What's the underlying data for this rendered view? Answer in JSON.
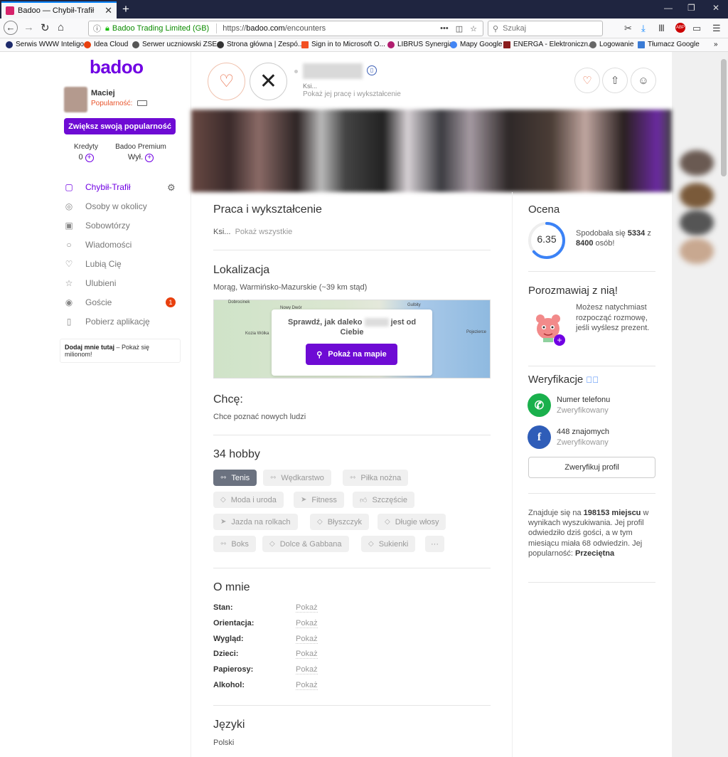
{
  "browser": {
    "tab_title": "Badoo — Chybił-Trafił",
    "cert_owner": "Badoo Trading Limited (GB)",
    "url_prefix": "https://",
    "url_host": "badoo.com",
    "url_path": "/encounters",
    "search_placeholder": "Szukaj",
    "bookmarks": [
      "Serwis WWW Inteligo",
      "Idea Cloud",
      "Serwer uczniowski ZSE...",
      "Strona główna | Zespó...",
      "Sign in to Microsoft O...",
      "LIBRUS Synergia",
      "Mapy Google",
      "ENERGA - Elektroniczn...",
      "Logowanie",
      "Tłumacz Google"
    ]
  },
  "sidebar": {
    "logo": "badoo",
    "user_name": "Maciej",
    "popularity_label": "Popularność:",
    "boost_button": "Zwiększ swoją popularność",
    "credits_label": "Kredyty",
    "credits_value": "0",
    "premium_label": "Badoo Premium",
    "premium_value": "Wył.",
    "nav": [
      {
        "label": "Chybił-Trafił",
        "icon": "encounters-icon",
        "active": true
      },
      {
        "label": "Osoby w okolicy",
        "icon": "people-nearby-icon"
      },
      {
        "label": "Sobowtórzy",
        "icon": "lookalikes-icon"
      },
      {
        "label": "Wiadomości",
        "icon": "messages-icon"
      },
      {
        "label": "Lubią Cię",
        "icon": "heart-icon"
      },
      {
        "label": "Ulubieni",
        "icon": "star-icon"
      },
      {
        "label": "Goście",
        "icon": "eye-icon"
      },
      {
        "label": "Pobierz aplikację",
        "icon": "phone-icon"
      }
    ],
    "visitors_badge": "1",
    "addme_bold": "Dodaj mnie tutaj",
    "addme_text": " – Pokaż się milionom!"
  },
  "profile": {
    "sub1": "Ksi...",
    "sub2": "Pokaż jej pracę i wykształcenie"
  },
  "main": {
    "work_title": "Praca i wykształcenie",
    "work_value": "Ksi...",
    "work_link": "Pokaż wszystkie",
    "location_title": "Lokalizacja",
    "location_value": "Morąg, Warmińsko-Mazurskie (~39 km stąd)",
    "map_labels": [
      "Dobrocinek",
      "Nowy Dwór",
      "Gulbity",
      "Kozia Wólka",
      "Pojezierce"
    ],
    "map_question_a": "Sprawdź, jak daleko",
    "map_question_b": "jest od Ciebie",
    "map_button": "Pokaż na mapie",
    "want_title": "Chcę:",
    "want_value": "Chce poznać nowych ludzi",
    "hobby_title": "34 hobby",
    "hobbies": [
      "Tenis",
      "Wędkarstwo",
      "Piłka nożna",
      "Moda i uroda",
      "Fitness",
      "Szczęście",
      "Jazda na rolkach",
      "Błyszczyk",
      "Długie włosy",
      "Boks",
      "Dolce & Gabbana",
      "Sukienki"
    ],
    "hobby_more": "···",
    "about_title": "O mnie",
    "about_fields": [
      {
        "label": "Stan:",
        "value": "Pokaż"
      },
      {
        "label": "Orientacja:",
        "value": "Pokaż"
      },
      {
        "label": "Wygląd:",
        "value": "Pokaż"
      },
      {
        "label": "Dzieci:",
        "value": "Pokaż"
      },
      {
        "label": "Papierosy:",
        "value": "Pokaż"
      },
      {
        "label": "Alkohol:",
        "value": "Pokaż"
      }
    ],
    "lang_title": "Języki",
    "lang_value": "Polski"
  },
  "right": {
    "rating_title": "Ocena",
    "rating_score": "6.35",
    "rating_fraction": 0.635,
    "liked_a": "Spodobała się ",
    "liked_count": "5334",
    "liked_b": " z ",
    "liked_total": "8400",
    "liked_c": " osób!",
    "talk_title": "Porozmawiaj z nią!",
    "talk_text": "Możesz natychmiast rozpocząć rozmowę, jeśli wyślesz prezent.",
    "verif_title": "Weryfikacje",
    "verif_phone": "Numer telefonu",
    "verif_phone_status": "Zweryfikowany",
    "verif_fb": "448 znajomych",
    "verif_fb_status": "Zweryfikowany",
    "verif_button": "Zweryfikuj profil",
    "rank_a": "Znajduje się na ",
    "rank_pos": "198153 miejscu",
    "rank_b": " w wynikach wyszukiwania. Jej profil odwiedziło dziś gości, a w tym miesiącu miała 68 odwiedzin. Jej popularność: ",
    "rank_pop": "Przeciętna"
  },
  "colors": {
    "brand": "#7000e3",
    "accent_orange": "#e8542b",
    "phone_green": "#1ab04c",
    "facebook_blue": "#2f5db8"
  }
}
